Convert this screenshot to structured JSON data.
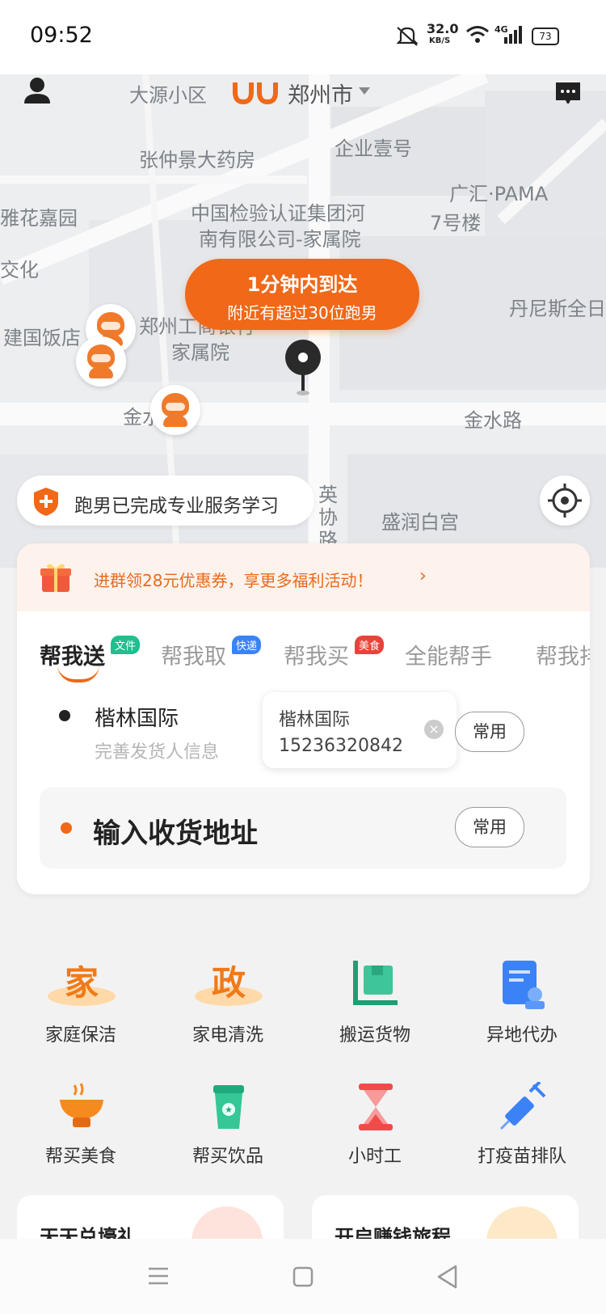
{
  "status_bar": {
    "time": "09:52",
    "net_speed": "32.0",
    "net_unit": "KB/S",
    "network": "4G",
    "battery": "73"
  },
  "header": {
    "logo_text": "UU",
    "city": "郑州市"
  },
  "map": {
    "labels": [
      "大源小区",
      "张仲景大药房",
      "企业壹号",
      "广汇·PAMA",
      "7号楼",
      "中国检验认证集团河",
      "南有限公司-家属院",
      "雅花嘉园",
      "交化",
      "丹尼斯全日",
      "郑州工商银行",
      "家属院",
      "建国饭店",
      "金水路",
      "金水路",
      "盛润白宫",
      "英",
      "协",
      "路"
    ],
    "bubble_title": "1分钟内到达",
    "bubble_subtitle": "附近有超过30位跑男"
  },
  "certified": {
    "text": "跑男已完成专业服务学习"
  },
  "promo": {
    "text": "进群领28元优惠券，享更多福利活动！",
    "arrow": "›"
  },
  "tabs": [
    {
      "label": "帮我送",
      "tag": "文件",
      "tag_color": "#1fbf8f"
    },
    {
      "label": "帮我取",
      "tag": "快递",
      "tag_color": "#3b82f6"
    },
    {
      "label": "帮我买",
      "tag": "美食",
      "tag_color": "#e8433a"
    },
    {
      "label": "全能帮手",
      "tag": "",
      "tag_color": ""
    },
    {
      "label": "帮我排",
      "tag": "",
      "tag_color": ""
    }
  ],
  "sender": {
    "name": "楷林国际",
    "subtitle": "完善发货人信息"
  },
  "contact": {
    "name": "楷林国际",
    "phone": "15236320842",
    "clear": "×"
  },
  "common_label": "常用",
  "receiver": {
    "placeholder": "输入收货地址"
  },
  "services": [
    {
      "label": "家庭保洁",
      "icon": "jia-icon",
      "glyph": "家"
    },
    {
      "label": "家电清洗",
      "icon": "zheng-icon",
      "glyph": "政"
    },
    {
      "label": "搬运货物",
      "icon": "cart-icon",
      "glyph": ""
    },
    {
      "label": "异地代办",
      "icon": "document-icon",
      "glyph": ""
    },
    {
      "label": "帮买美食",
      "icon": "food-icon",
      "glyph": ""
    },
    {
      "label": "帮买饮品",
      "icon": "drink-icon",
      "glyph": ""
    },
    {
      "label": "小时工",
      "icon": "hourglass-icon",
      "glyph": ""
    },
    {
      "label": "打疫苗排队",
      "icon": "syringe-icon",
      "glyph": ""
    }
  ],
  "bottom_cards": [
    {
      "title": "天天兑壕礼"
    },
    {
      "title": "开启赚钱旅程"
    }
  ],
  "colors": {
    "accent": "#f06818",
    "map_bg": "#eceef0",
    "page_bg": "#f2f2f2"
  }
}
